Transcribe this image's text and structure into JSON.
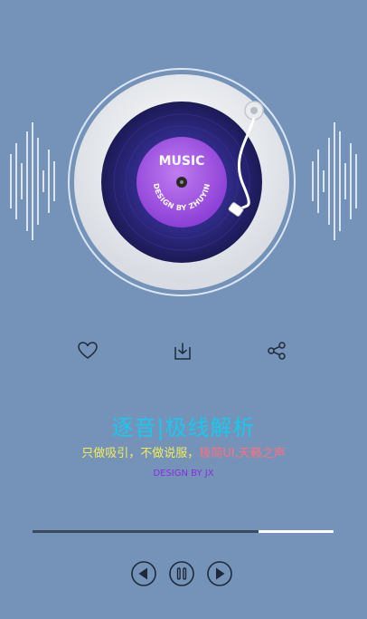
{
  "disc": {
    "label_top": "MUSIC",
    "label_bottom": "DESIGN BY ZHUYIN"
  },
  "actions": {
    "like_icon": "heart-icon",
    "download_icon": "download-icon",
    "share_icon": "share-icon"
  },
  "song": {
    "title": "逐音|极线解析",
    "tagline_part1": "只做吸引，不做说服，",
    "tagline_part2": "极简UI,天籁之声",
    "credit": "DESIGN BY JX"
  },
  "playback": {
    "progress": 0.75
  },
  "controls": {
    "prev_icon": "previous-icon",
    "pause_icon": "pause-icon",
    "next_icon": "next-icon"
  },
  "colors": {
    "background": "#7593b8",
    "title": "#19c8ef",
    "tagline_yellow": "#f2ec5a",
    "tagline_red": "#ff6f7f",
    "credit": "#8a2be2",
    "vinyl": "#2c2a7a",
    "label": "#a35be0"
  }
}
